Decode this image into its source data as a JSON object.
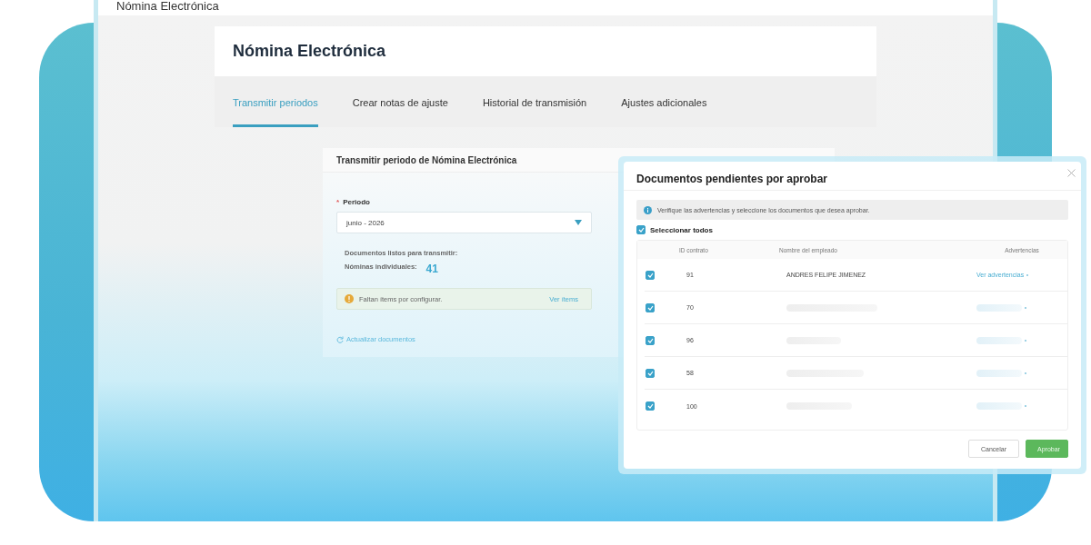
{
  "window": {
    "title": "Nómina Electrónica"
  },
  "header": {
    "title": "Nómina Electrónica"
  },
  "tabs": [
    {
      "label": "Transmitir periodos",
      "selected": true
    },
    {
      "label": "Crear notas de ajuste",
      "selected": false
    },
    {
      "label": "Historial de transmisión",
      "selected": false
    },
    {
      "label": "Ajustes adicionales",
      "selected": false
    }
  ],
  "form": {
    "title": "Transmitir periodo de Nómina Electrónica",
    "period_label": "Periodo",
    "required_mark": "*",
    "period_value": "junio - 2026",
    "ready_label": "Documentos listos para transmitir:",
    "count_label": "Nóminas individuales:",
    "count": "41",
    "alert": {
      "text": "Faltan ítems por configurar.",
      "link": "Ver ítems"
    },
    "refresh_link": "Actualizar documentos"
  },
  "modal": {
    "title": "Documentos pendientes por aprobar",
    "info": "Verifique las advertencias y seleccione los documentos que desea aprobar.",
    "select_all": {
      "label": "Seleccionar todos",
      "checked": true
    },
    "columns": [
      "ID contrato",
      "Nombre del empleado",
      "Advertencias"
    ],
    "rows": [
      {
        "id": "91",
        "name": "ANDRES FELIPE JIMENEZ",
        "warnings": "Ver advertencias",
        "checked": true
      },
      {
        "id": "70",
        "checked": true
      },
      {
        "id": "96",
        "checked": true
      },
      {
        "id": "58",
        "checked": true
      },
      {
        "id": "100",
        "checked": true
      }
    ],
    "buttons": {
      "cancel": "Cancelar",
      "approve": "Aprobar"
    }
  }
}
